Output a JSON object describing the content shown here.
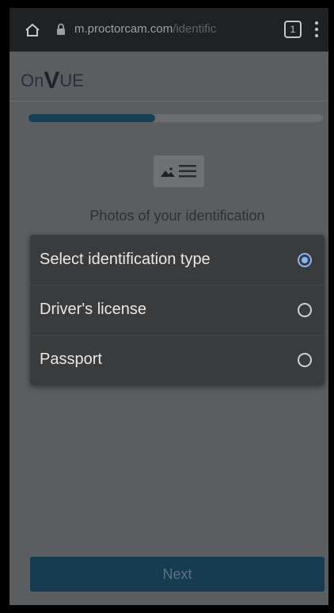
{
  "browser": {
    "url_host": "m.proctorcam.com",
    "url_path": "/identific",
    "tab_count": "1"
  },
  "app": {
    "logo_prefix": "On",
    "logo_v": "V",
    "logo_suffix": "UE"
  },
  "progress": {
    "value": 0.43
  },
  "page": {
    "subtitle": "Photos of your identification"
  },
  "dialog": {
    "options": [
      {
        "label": "Select identification type",
        "selected": true
      },
      {
        "label": "Driver's license",
        "selected": false
      },
      {
        "label": "Passport",
        "selected": false
      }
    ]
  },
  "actions": {
    "next_label": "Next"
  },
  "colors": {
    "accent": "#153f55",
    "radio_selected": "#8ab4f8"
  },
  "icons": [
    "home-icon",
    "lock-icon",
    "tabs-icon",
    "more-vert-icon",
    "id-card-icon",
    "radio-selected-icon",
    "radio-unselected-icon"
  ]
}
